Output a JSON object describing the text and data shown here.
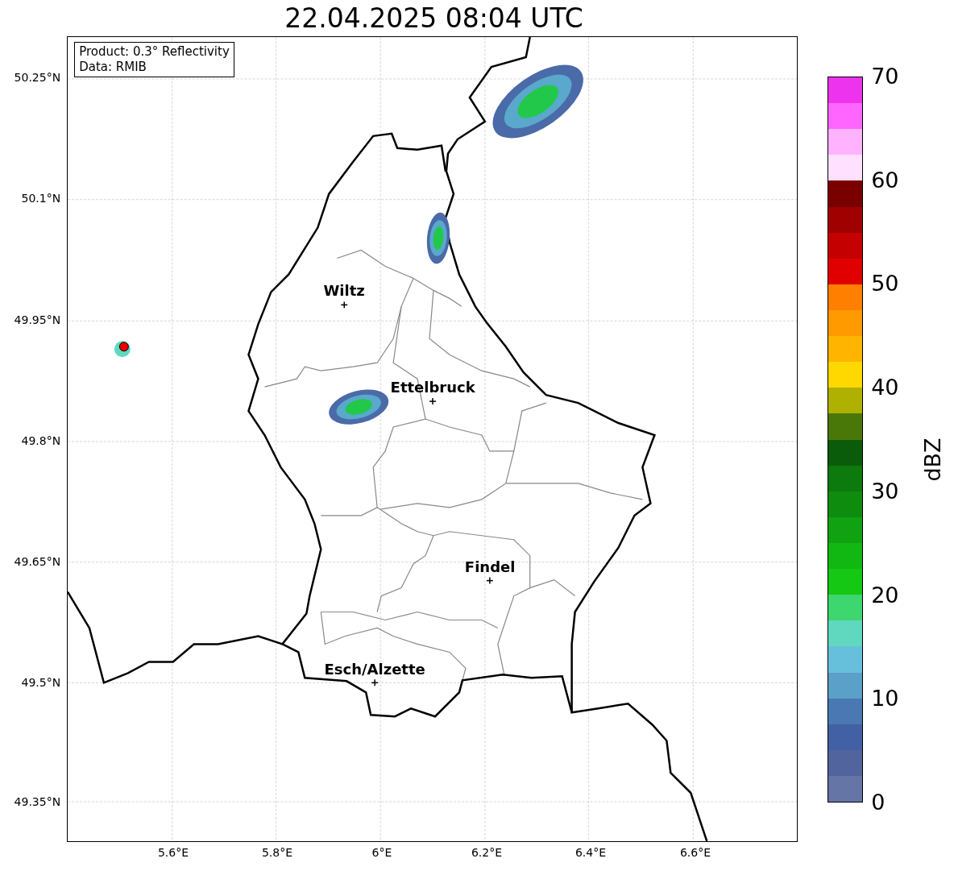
{
  "title": "22.04.2025 08:04 UTC",
  "info_box": {
    "lines": [
      "Product: 0.3° Reflectivity",
      "Data: RMIB"
    ]
  },
  "cities": [
    {
      "name": "Wiltz"
    },
    {
      "name": "Ettelbruck"
    },
    {
      "name": "Findel"
    },
    {
      "name": "Esch/Alzette"
    }
  ],
  "y_ticks": [
    "50.25°N",
    "50.1°N",
    "49.95°N",
    "49.8°N",
    "49.65°N",
    "49.5°N",
    "49.35°N"
  ],
  "x_ticks": [
    "5.6°E",
    "5.8°E",
    "6°E",
    "6.2°E",
    "6.4°E",
    "6.6°E"
  ],
  "colorbar": {
    "label": "dBZ",
    "ticks": [
      "70",
      "60",
      "50",
      "40",
      "30",
      "20",
      "10",
      "0"
    ],
    "segments": [
      {
        "color": "#ee33ee"
      },
      {
        "color": "#ff66ff"
      },
      {
        "color": "#ffb3ff"
      },
      {
        "color": "#ffe0ff"
      },
      {
        "color": "#7a0000"
      },
      {
        "color": "#a00000"
      },
      {
        "color": "#c40000"
      },
      {
        "color": "#e00000"
      },
      {
        "color": "#ff7f00"
      },
      {
        "color": "#ff9a00"
      },
      {
        "color": "#ffb400"
      },
      {
        "color": "#ffd800"
      },
      {
        "color": "#b0b000"
      },
      {
        "color": "#4a7808"
      },
      {
        "color": "#0a5c0a"
      },
      {
        "color": "#0c7a0c"
      },
      {
        "color": "#0e8c0e"
      },
      {
        "color": "#10a210"
      },
      {
        "color": "#12b812"
      },
      {
        "color": "#14c814"
      },
      {
        "color": "#3ed66e"
      },
      {
        "color": "#60d8c0"
      },
      {
        "color": "#66c0dc"
      },
      {
        "color": "#5aa0c8"
      },
      {
        "color": "#4a78b2"
      },
      {
        "color": "#4260a4"
      },
      {
        "color": "#52649e"
      },
      {
        "color": "#6475a6"
      }
    ]
  }
}
